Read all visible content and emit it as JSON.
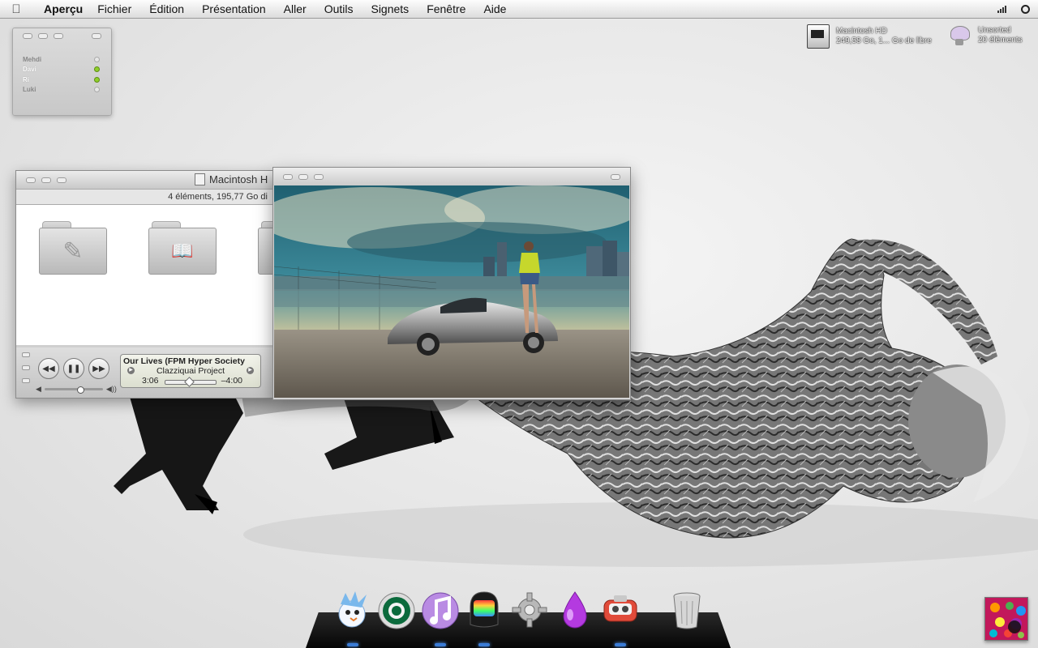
{
  "menubar": {
    "apple": "",
    "app_name": "Aperçu",
    "items": [
      "Fichier",
      "Édition",
      "Présentation",
      "Aller",
      "Outils",
      "Signets",
      "Fenêtre",
      "Aide"
    ]
  },
  "buddy_widget": {
    "contacts": [
      {
        "name": "Mehdi",
        "online": false
      },
      {
        "name": "Davi",
        "online": true
      },
      {
        "name": "Ri",
        "online": true
      },
      {
        "name": "Luki",
        "online": false
      }
    ]
  },
  "desktop": {
    "hd": {
      "name": "Macintosh HD",
      "info": "249,58 Go, 1... Go de libre",
      "icon": "hard-drive-icon"
    },
    "folder": {
      "name": "Unsorted",
      "info": "20 éléments",
      "icon": "bat-folder-icon"
    }
  },
  "finder": {
    "title": "Macintosh H",
    "status": "4 éléments, 195,77 Go di",
    "folders": [
      {
        "icon": "applications-folder-icon",
        "glyph": "✎"
      },
      {
        "icon": "library-folder-icon",
        "glyph": "📖"
      },
      {
        "icon": "folder-icon",
        "glyph": ""
      }
    ]
  },
  "player": {
    "song": "Our Lives (FPM Hyper Society",
    "artist": "Clazziquai Project",
    "elapsed": "3:06",
    "remaining": "–4:00",
    "progress": 0.43,
    "volume": 0.6,
    "prev_glyph": "◀◀",
    "play_glyph": "❚❚",
    "next_glyph": "▶▶"
  },
  "preview": {
    "title": ""
  },
  "dock": {
    "items": [
      {
        "icon": "pidgin-bird-icon",
        "running": true
      },
      {
        "icon": "starbucks-icon",
        "running": false
      },
      {
        "icon": "itunes-icon",
        "running": true
      },
      {
        "icon": "daft-punk-helmet-icon",
        "running": true
      },
      {
        "icon": "system-preferences-gear-icon",
        "running": false
      },
      {
        "icon": "purple-drop-icon",
        "running": false
      },
      {
        "icon": "preview-viewer-icon",
        "running": true
      },
      {
        "icon": "trash-icon",
        "running": false
      }
    ]
  },
  "colors": {
    "menubar": "#e6e6e6",
    "online_led": "#8fcf2a",
    "dock": "#111111",
    "accent": "#3a7bd5"
  }
}
